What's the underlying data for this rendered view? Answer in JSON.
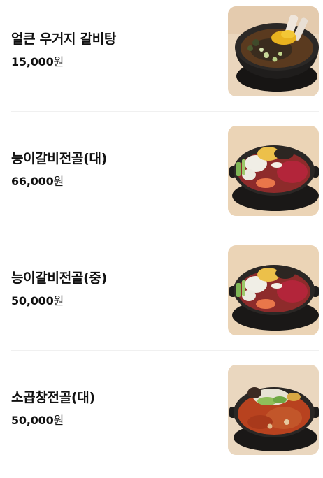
{
  "menu": {
    "items": [
      {
        "name": "얼큰 우거지 갈비탕",
        "price": "15,000",
        "currency": "원",
        "icon": "galbitang-photo"
      },
      {
        "name": "능이갈비전골(대)",
        "price": "66,000",
        "currency": "원",
        "icon": "neungi-galbi-jeongol-photo"
      },
      {
        "name": "능이갈비전골(중)",
        "price": "50,000",
        "currency": "원",
        "icon": "neungi-galbi-jeongol-photo"
      },
      {
        "name": "소곱창전골(대)",
        "price": "50,000",
        "currency": "원",
        "icon": "gopchang-jeongol-photo"
      }
    ]
  },
  "colors": {
    "text": "#111111",
    "divider": "#f0f0f0",
    "photo_background": "#ead6bd",
    "pot": "#1e1c1b"
  }
}
